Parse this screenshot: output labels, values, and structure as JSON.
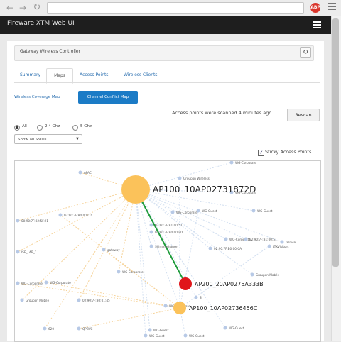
{
  "browser": {
    "back_icon": "arrow-left-icon",
    "forward_icon": "arrow-right-icon",
    "reload_icon": "reload-icon",
    "extension_label": "ABP"
  },
  "app": {
    "title": "Fireware XTM Web UI",
    "menu_icon": "hamburger-icon"
  },
  "section": {
    "title": "Gateway Wireless Controller"
  },
  "tabs": [
    {
      "label": "Summary",
      "active": false
    },
    {
      "label": "Maps",
      "active": true
    },
    {
      "label": "Access Points",
      "active": false
    },
    {
      "label": "Wireless Clients",
      "active": false
    }
  ],
  "subtabs": [
    {
      "label": "Wireless Coverage Map",
      "active": false
    },
    {
      "label": "Channel Conflict Map",
      "active": true
    }
  ],
  "scan": {
    "status": "Access points were scanned 4 minutes ago",
    "button_label": "Rescan"
  },
  "bands": [
    {
      "label": "All",
      "selected": true
    },
    {
      "label": "2.4 Ghz",
      "selected": false
    },
    {
      "label": "5 Ghz",
      "selected": false
    }
  ],
  "ssid_filter": {
    "selected": "Show all SSIDs"
  },
  "sticky": {
    "label": "Sticky Access Points",
    "checked": true
  },
  "colors": {
    "accent": "#1b7bc6",
    "ap_primary": "#fbc25a",
    "ap_conflict": "#e0161b",
    "conflict_link": "#1e9b3b",
    "neighbor_dot": "#b7c9e6"
  },
  "map": {
    "aps": [
      {
        "label": "AP100_10AP02731872D",
        "status": "primary"
      },
      {
        "label": "AP200_20AP0275A333B",
        "status": "conflict"
      },
      {
        "label": "AP100_10AP02736456C",
        "status": "primary"
      }
    ],
    "neighbors": [
      "APAC",
      "Groupon Wireless",
      "WG-Corporate",
      "WG-Corporate",
      "WG-Guest",
      "WG-Guest",
      "WG-Corporate",
      "02:90:7F:B0:00:CD",
      "00:90:7F:B2:5F:21",
      "02:90:7F:B1:00:51",
      "02:90:7F:B0:00:FD",
      "WG-Corporate",
      "02:90:7F:B1:00:51",
      "LTKVisitors",
      "telnice",
      "ISE_LAB_1",
      "gateway",
      "Shimmerhause",
      "02:90:7F:B0:00:CA",
      "WG-Corporate",
      "WG-Corporate",
      "Groupon Mobile",
      "WG-Corporate",
      "Groupon Mobile",
      "02:90:7F:B0:01:45",
      "WG-Corporate",
      "S",
      "620",
      "QPBVC",
      "WG-Guest",
      "WG-Guest",
      "WG-Guest",
      "WG-Guest"
    ]
  }
}
